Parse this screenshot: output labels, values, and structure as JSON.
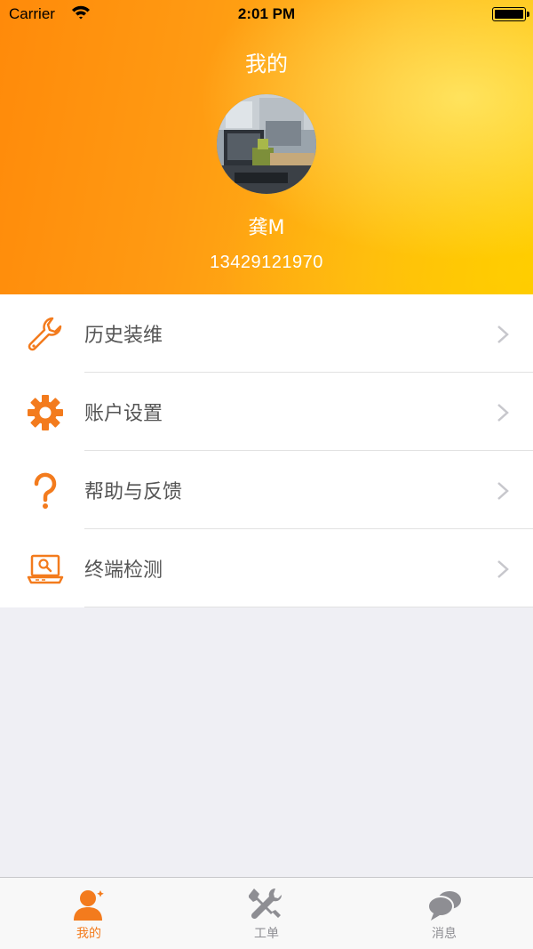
{
  "status_bar": {
    "carrier": "Carrier",
    "time": "2:01 PM"
  },
  "header": {
    "title": "我的",
    "username": "龚M",
    "phone": "13429121970"
  },
  "menu": [
    {
      "label": "历史装维",
      "icon": "wrench-icon"
    },
    {
      "label": "账户设置",
      "icon": "gear-icon"
    },
    {
      "label": "帮助与反馈",
      "icon": "question-icon"
    },
    {
      "label": "终端检测",
      "icon": "laptop-search-icon"
    }
  ],
  "tabs": [
    {
      "label": "我的",
      "icon": "person-icon",
      "active": true
    },
    {
      "label": "工单",
      "icon": "tools-icon",
      "active": false
    },
    {
      "label": "消息",
      "icon": "chat-bubbles-icon",
      "active": false
    }
  ],
  "colors": {
    "accent": "#f37b1d",
    "inactive": "#8e8e93"
  }
}
